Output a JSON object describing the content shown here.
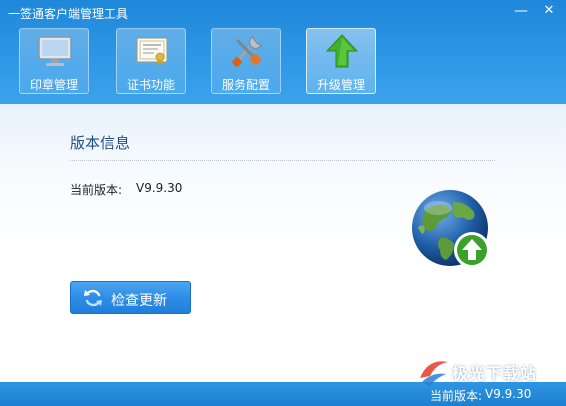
{
  "window": {
    "title": "一签通客户端管理工具",
    "minimize_glyph": "—",
    "close_glyph": "✕"
  },
  "toolbar": {
    "items": [
      {
        "label": "印章管理",
        "icon": "monitor-icon"
      },
      {
        "label": "证书功能",
        "icon": "certificate-icon"
      },
      {
        "label": "服务配置",
        "icon": "tools-icon"
      },
      {
        "label": "升级管理",
        "icon": "upgrade-arrow-icon",
        "active": true
      }
    ]
  },
  "main": {
    "section_title": "版本信息",
    "version_label": "当前版本:",
    "version_value": "V9.9.30",
    "check_update_label": "检查更新"
  },
  "statusbar": {
    "version_label": "当前版本:",
    "version_value": "V9.9.30"
  },
  "watermark": {
    "text": "极光下载站"
  },
  "colors": {
    "header_blue": "#2d97e6",
    "button_blue": "#2e8ee6",
    "section_title": "#1f4f86",
    "upgrade_green": "#3fb22a"
  }
}
